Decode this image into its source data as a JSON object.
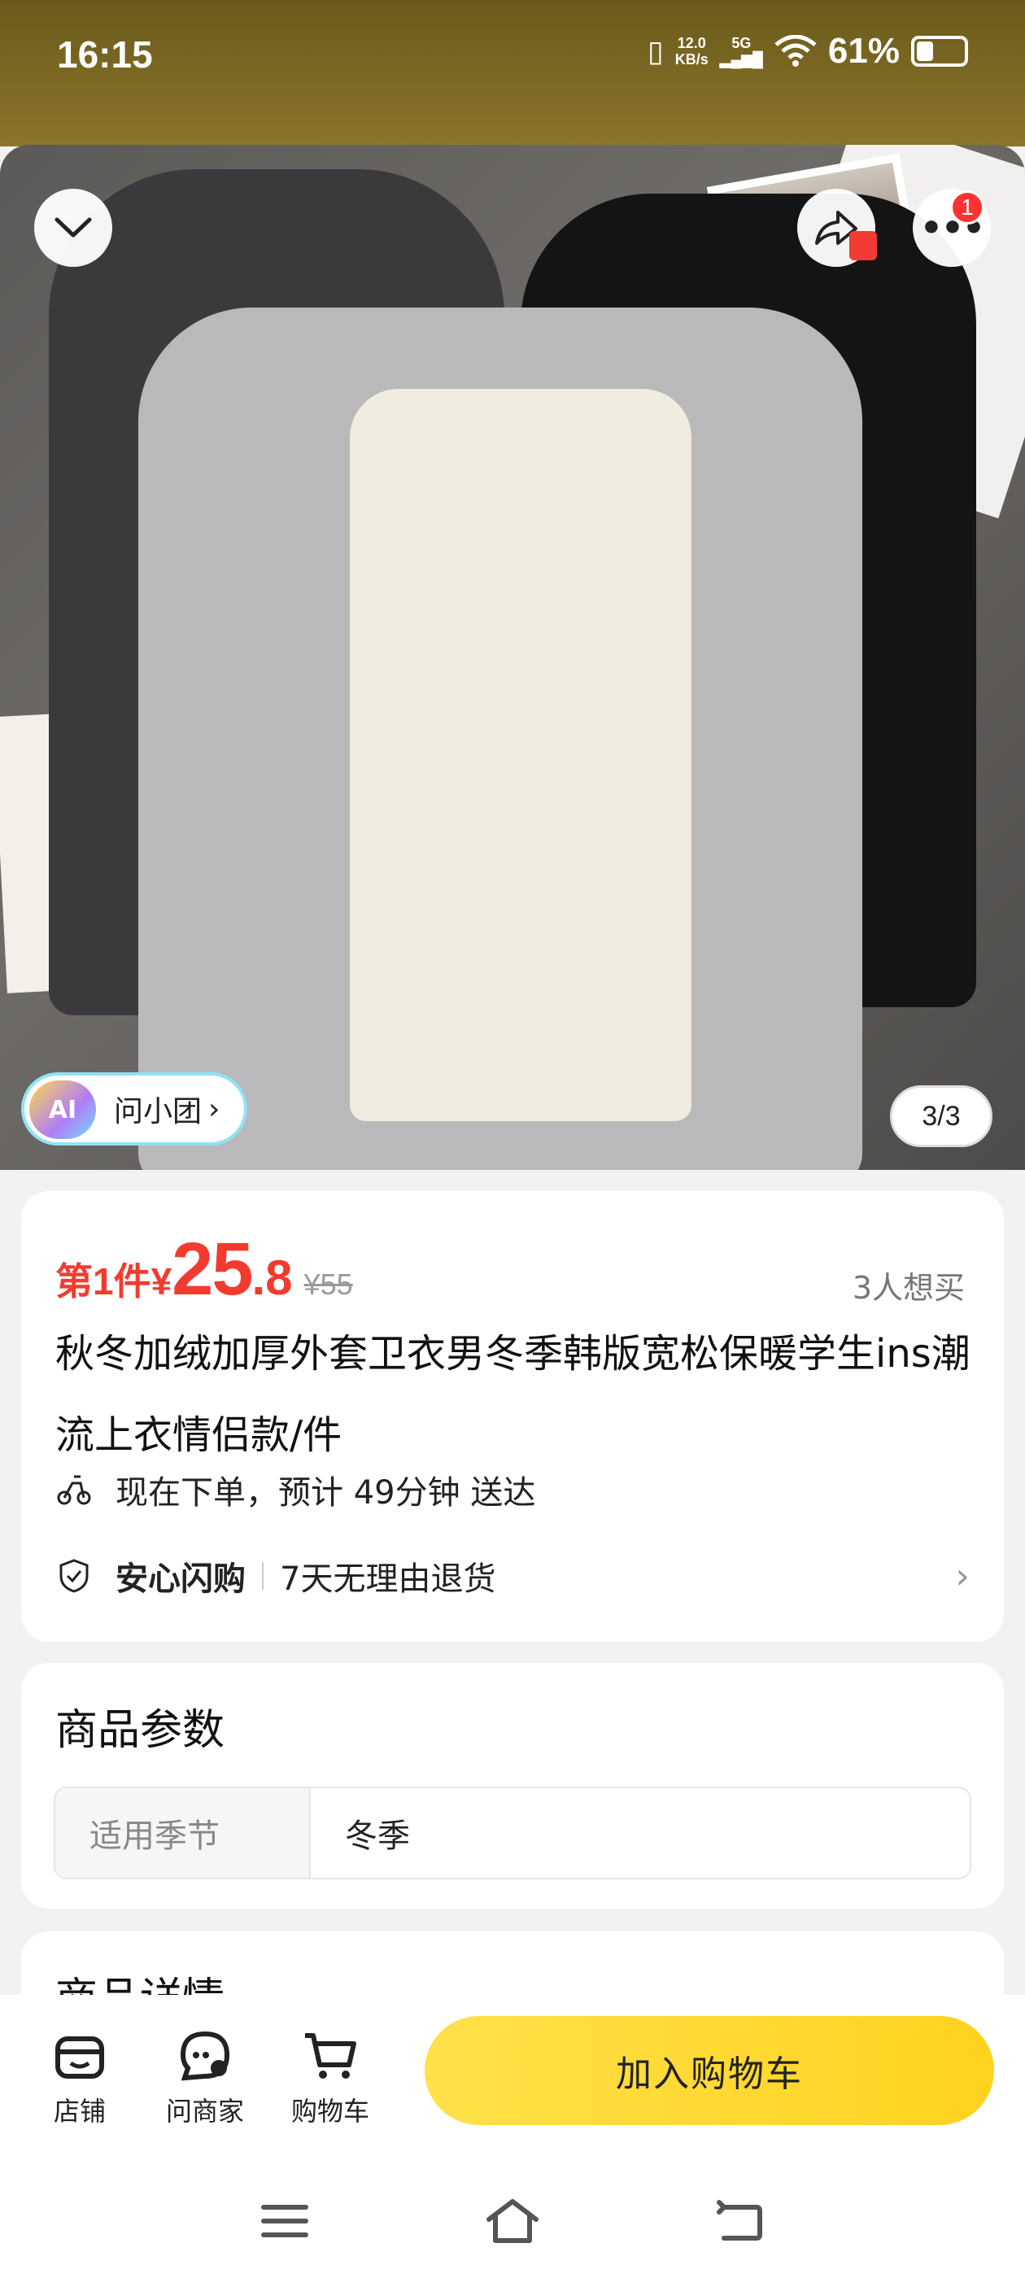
{
  "status_bar": {
    "time": "16:15",
    "net_speed_value": "12.0",
    "net_speed_unit": "KB/s",
    "signal_label": "5G",
    "battery": "61%"
  },
  "hero": {
    "ask_label": "问小团",
    "ask_logo": "AI",
    "page_indicator": "3/3",
    "badge_count": "1"
  },
  "product": {
    "price_prefix": "第1件¥",
    "price_int": "25",
    "price_dec": ".8",
    "original_price": "¥55",
    "want_count": "3人想买",
    "title": "秋冬加绒加厚外套卫衣男冬季韩版宽松保暖学生ins潮流上衣情侣款/件",
    "delivery": "现在下单，预计 49分钟 送达",
    "guarantee_brand": "安心闪购",
    "guarantee_text": "7天无理由退货"
  },
  "params": {
    "section_title": "商品参数",
    "rows": [
      {
        "key": "适用季节",
        "value": "冬季"
      }
    ]
  },
  "details": {
    "section_title": "商品详情"
  },
  "bottom_bar": {
    "shop_label": "店铺",
    "chat_label": "问商家",
    "cart_label": "购物车",
    "add_to_cart": "加入购物车"
  },
  "colors": {
    "price": "#f23b2f",
    "cart_button": "#ffd21e",
    "status_bar": "#7a6824"
  }
}
